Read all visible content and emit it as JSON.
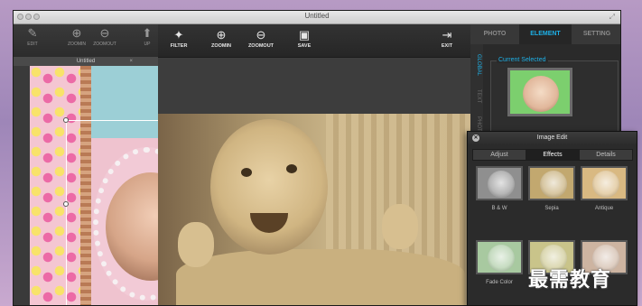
{
  "window": {
    "title": "Untitled"
  },
  "left_toolbar": {
    "items": [
      {
        "label": "EDIT",
        "icon": "edit-icon",
        "glyph": "✎"
      },
      {
        "label": "ZOOMIN",
        "icon": "zoom-in-icon",
        "glyph": "⊕"
      },
      {
        "label": "ZOOMOUT",
        "icon": "zoom-out-icon",
        "glyph": "⊖"
      },
      {
        "label": "UP",
        "icon": "arrow-up-icon",
        "glyph": "⬆"
      }
    ],
    "doc_tab": "Untitled"
  },
  "center_toolbar": {
    "items": [
      {
        "label": "FILTER",
        "icon": "magic-wand-icon",
        "glyph": "✦"
      },
      {
        "label": "ZOOMIN",
        "icon": "zoom-in-icon",
        "glyph": "⊕"
      },
      {
        "label": "ZOOMOUT",
        "icon": "zoom-out-icon",
        "glyph": "⊖"
      },
      {
        "label": "SAVE",
        "icon": "floppy-disk-icon",
        "glyph": "▣"
      },
      {
        "label": "EXIT",
        "icon": "exit-icon",
        "glyph": "⇥"
      }
    ]
  },
  "right_panel": {
    "tabs": [
      {
        "label": "PHOTO",
        "active": false
      },
      {
        "label": "ELEMENT",
        "active": true
      },
      {
        "label": "SETTING",
        "active": false
      }
    ],
    "side_tabs": [
      "GLOBAL",
      "TEXT",
      "PHOTO"
    ],
    "current_selected_title": "Current Selected"
  },
  "image_edit": {
    "title": "Image Edit",
    "tabs": [
      {
        "label": "Adjust",
        "active": false
      },
      {
        "label": "Effects",
        "active": true
      },
      {
        "label": "Details",
        "active": false
      }
    ],
    "effects": [
      {
        "label": "B & W",
        "tint": "#8f8f8f"
      },
      {
        "label": "Sepia",
        "tint": "#c2a86f"
      },
      {
        "label": "Antique",
        "tint": "#d9b982"
      },
      {
        "label": "Fade Color",
        "tint": "#a8c9a0"
      },
      {
        "label": "",
        "tint": "#c9c48a"
      },
      {
        "label": "",
        "tint": "#cdb4a1"
      }
    ]
  },
  "colors": {
    "accent": "#1eb0e6",
    "toolbar": "#2b2b2b"
  },
  "watermark": "最需教育"
}
